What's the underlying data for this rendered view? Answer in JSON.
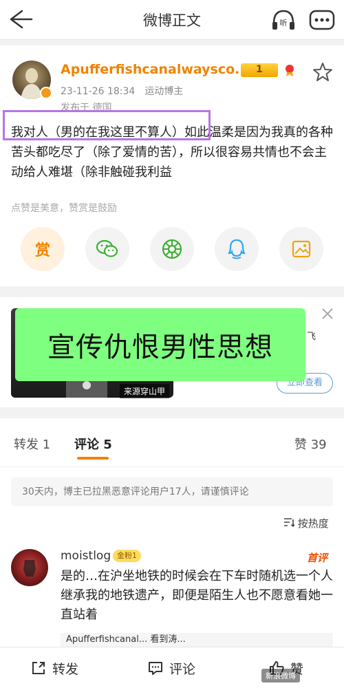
{
  "header": {
    "title": "微博正文",
    "listen_label": "听"
  },
  "post": {
    "username": "Apufferfishcanalwaysco...",
    "vip_level": "1",
    "timestamp": "23-11-26 18:34",
    "source": "运动博主",
    "published_from": "发布于 德国",
    "body": "我对人（男的在我这里不算人）如此温柔是因为我真的各种苦头都吃尽了（除了爱情的苦），所以很容易共情也不会主动给人难堪（除非触碰我利益",
    "reward_hint": "点赞是美意，赞赏是鼓励",
    "reward_label": "赏"
  },
  "ad": {
    "source_label": "来源穿山甲",
    "fei_text": "飞",
    "cta": "立即查看"
  },
  "overlay": {
    "text": "宣传仇恨男性思想"
  },
  "tabs": {
    "repost": "转发 1",
    "comment": "评论 5",
    "like": "赞 39"
  },
  "notice": "30天内，博主已拉黑恶意评论用户17人，请谨慎评论",
  "sort": "按热度",
  "comment": {
    "username": "moistlog",
    "fan_badge": "金粉1",
    "first_label": "首评",
    "text": "是的…在沪坐地铁的时候会在下车时随机选一个人继承我的地铁遗产，即便是陌生人也不愿意看她一直站着",
    "reply_preview": "Apufferfishcanal...  看到涛..."
  },
  "bottom": {
    "repost": "转发",
    "comment": "评论",
    "like": "赞"
  },
  "watermark": "新浪微博",
  "colors": {
    "accent": "#f08300",
    "highlight_border": "#b674e6",
    "overlay_bg": "#7fff7f"
  }
}
